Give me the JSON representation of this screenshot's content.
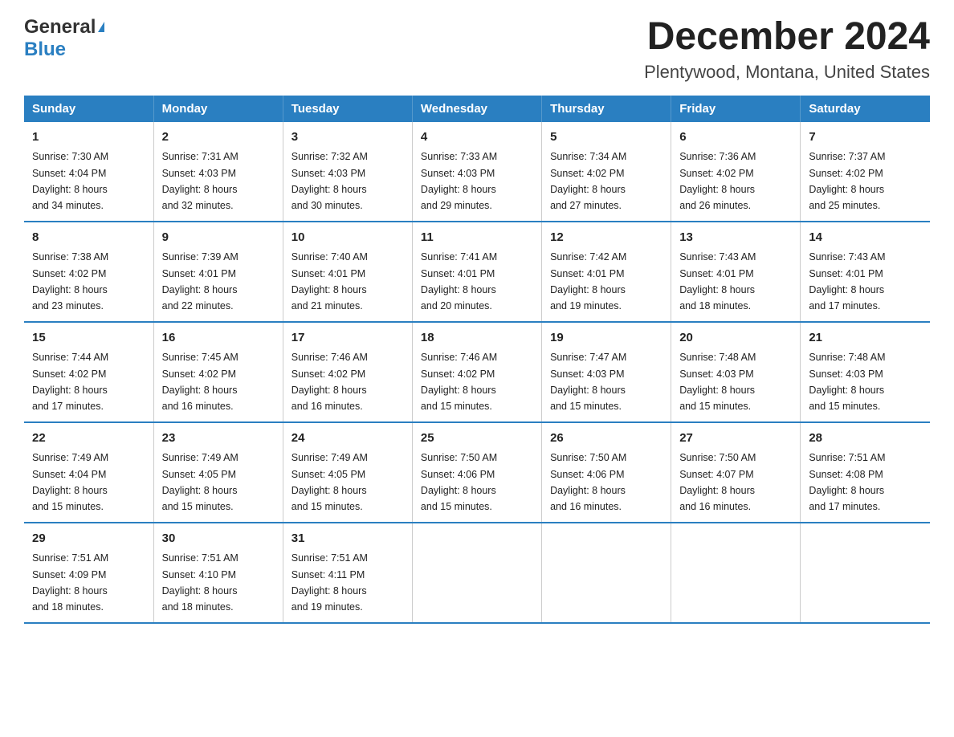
{
  "header": {
    "logo_general": "General",
    "logo_blue": "Blue",
    "title": "December 2024",
    "subtitle": "Plentywood, Montana, United States"
  },
  "days_of_week": [
    "Sunday",
    "Monday",
    "Tuesday",
    "Wednesday",
    "Thursday",
    "Friday",
    "Saturday"
  ],
  "weeks": [
    [
      {
        "day": "1",
        "sunrise": "7:30 AM",
        "sunset": "4:04 PM",
        "daylight": "8 hours and 34 minutes."
      },
      {
        "day": "2",
        "sunrise": "7:31 AM",
        "sunset": "4:03 PM",
        "daylight": "8 hours and 32 minutes."
      },
      {
        "day": "3",
        "sunrise": "7:32 AM",
        "sunset": "4:03 PM",
        "daylight": "8 hours and 30 minutes."
      },
      {
        "day": "4",
        "sunrise": "7:33 AM",
        "sunset": "4:03 PM",
        "daylight": "8 hours and 29 minutes."
      },
      {
        "day": "5",
        "sunrise": "7:34 AM",
        "sunset": "4:02 PM",
        "daylight": "8 hours and 27 minutes."
      },
      {
        "day": "6",
        "sunrise": "7:36 AM",
        "sunset": "4:02 PM",
        "daylight": "8 hours and 26 minutes."
      },
      {
        "day": "7",
        "sunrise": "7:37 AM",
        "sunset": "4:02 PM",
        "daylight": "8 hours and 25 minutes."
      }
    ],
    [
      {
        "day": "8",
        "sunrise": "7:38 AM",
        "sunset": "4:02 PM",
        "daylight": "8 hours and 23 minutes."
      },
      {
        "day": "9",
        "sunrise": "7:39 AM",
        "sunset": "4:01 PM",
        "daylight": "8 hours and 22 minutes."
      },
      {
        "day": "10",
        "sunrise": "7:40 AM",
        "sunset": "4:01 PM",
        "daylight": "8 hours and 21 minutes."
      },
      {
        "day": "11",
        "sunrise": "7:41 AM",
        "sunset": "4:01 PM",
        "daylight": "8 hours and 20 minutes."
      },
      {
        "day": "12",
        "sunrise": "7:42 AM",
        "sunset": "4:01 PM",
        "daylight": "8 hours and 19 minutes."
      },
      {
        "day": "13",
        "sunrise": "7:43 AM",
        "sunset": "4:01 PM",
        "daylight": "8 hours and 18 minutes."
      },
      {
        "day": "14",
        "sunrise": "7:43 AM",
        "sunset": "4:01 PM",
        "daylight": "8 hours and 17 minutes."
      }
    ],
    [
      {
        "day": "15",
        "sunrise": "7:44 AM",
        "sunset": "4:02 PM",
        "daylight": "8 hours and 17 minutes."
      },
      {
        "day": "16",
        "sunrise": "7:45 AM",
        "sunset": "4:02 PM",
        "daylight": "8 hours and 16 minutes."
      },
      {
        "day": "17",
        "sunrise": "7:46 AM",
        "sunset": "4:02 PM",
        "daylight": "8 hours and 16 minutes."
      },
      {
        "day": "18",
        "sunrise": "7:46 AM",
        "sunset": "4:02 PM",
        "daylight": "8 hours and 15 minutes."
      },
      {
        "day": "19",
        "sunrise": "7:47 AM",
        "sunset": "4:03 PM",
        "daylight": "8 hours and 15 minutes."
      },
      {
        "day": "20",
        "sunrise": "7:48 AM",
        "sunset": "4:03 PM",
        "daylight": "8 hours and 15 minutes."
      },
      {
        "day": "21",
        "sunrise": "7:48 AM",
        "sunset": "4:03 PM",
        "daylight": "8 hours and 15 minutes."
      }
    ],
    [
      {
        "day": "22",
        "sunrise": "7:49 AM",
        "sunset": "4:04 PM",
        "daylight": "8 hours and 15 minutes."
      },
      {
        "day": "23",
        "sunrise": "7:49 AM",
        "sunset": "4:05 PM",
        "daylight": "8 hours and 15 minutes."
      },
      {
        "day": "24",
        "sunrise": "7:49 AM",
        "sunset": "4:05 PM",
        "daylight": "8 hours and 15 minutes."
      },
      {
        "day": "25",
        "sunrise": "7:50 AM",
        "sunset": "4:06 PM",
        "daylight": "8 hours and 15 minutes."
      },
      {
        "day": "26",
        "sunrise": "7:50 AM",
        "sunset": "4:06 PM",
        "daylight": "8 hours and 16 minutes."
      },
      {
        "day": "27",
        "sunrise": "7:50 AM",
        "sunset": "4:07 PM",
        "daylight": "8 hours and 16 minutes."
      },
      {
        "day": "28",
        "sunrise": "7:51 AM",
        "sunset": "4:08 PM",
        "daylight": "8 hours and 17 minutes."
      }
    ],
    [
      {
        "day": "29",
        "sunrise": "7:51 AM",
        "sunset": "4:09 PM",
        "daylight": "8 hours and 18 minutes."
      },
      {
        "day": "30",
        "sunrise": "7:51 AM",
        "sunset": "4:10 PM",
        "daylight": "8 hours and 18 minutes."
      },
      {
        "day": "31",
        "sunrise": "7:51 AM",
        "sunset": "4:11 PM",
        "daylight": "8 hours and 19 minutes."
      },
      null,
      null,
      null,
      null
    ]
  ],
  "labels": {
    "sunrise": "Sunrise:",
    "sunset": "Sunset:",
    "daylight": "Daylight:"
  }
}
